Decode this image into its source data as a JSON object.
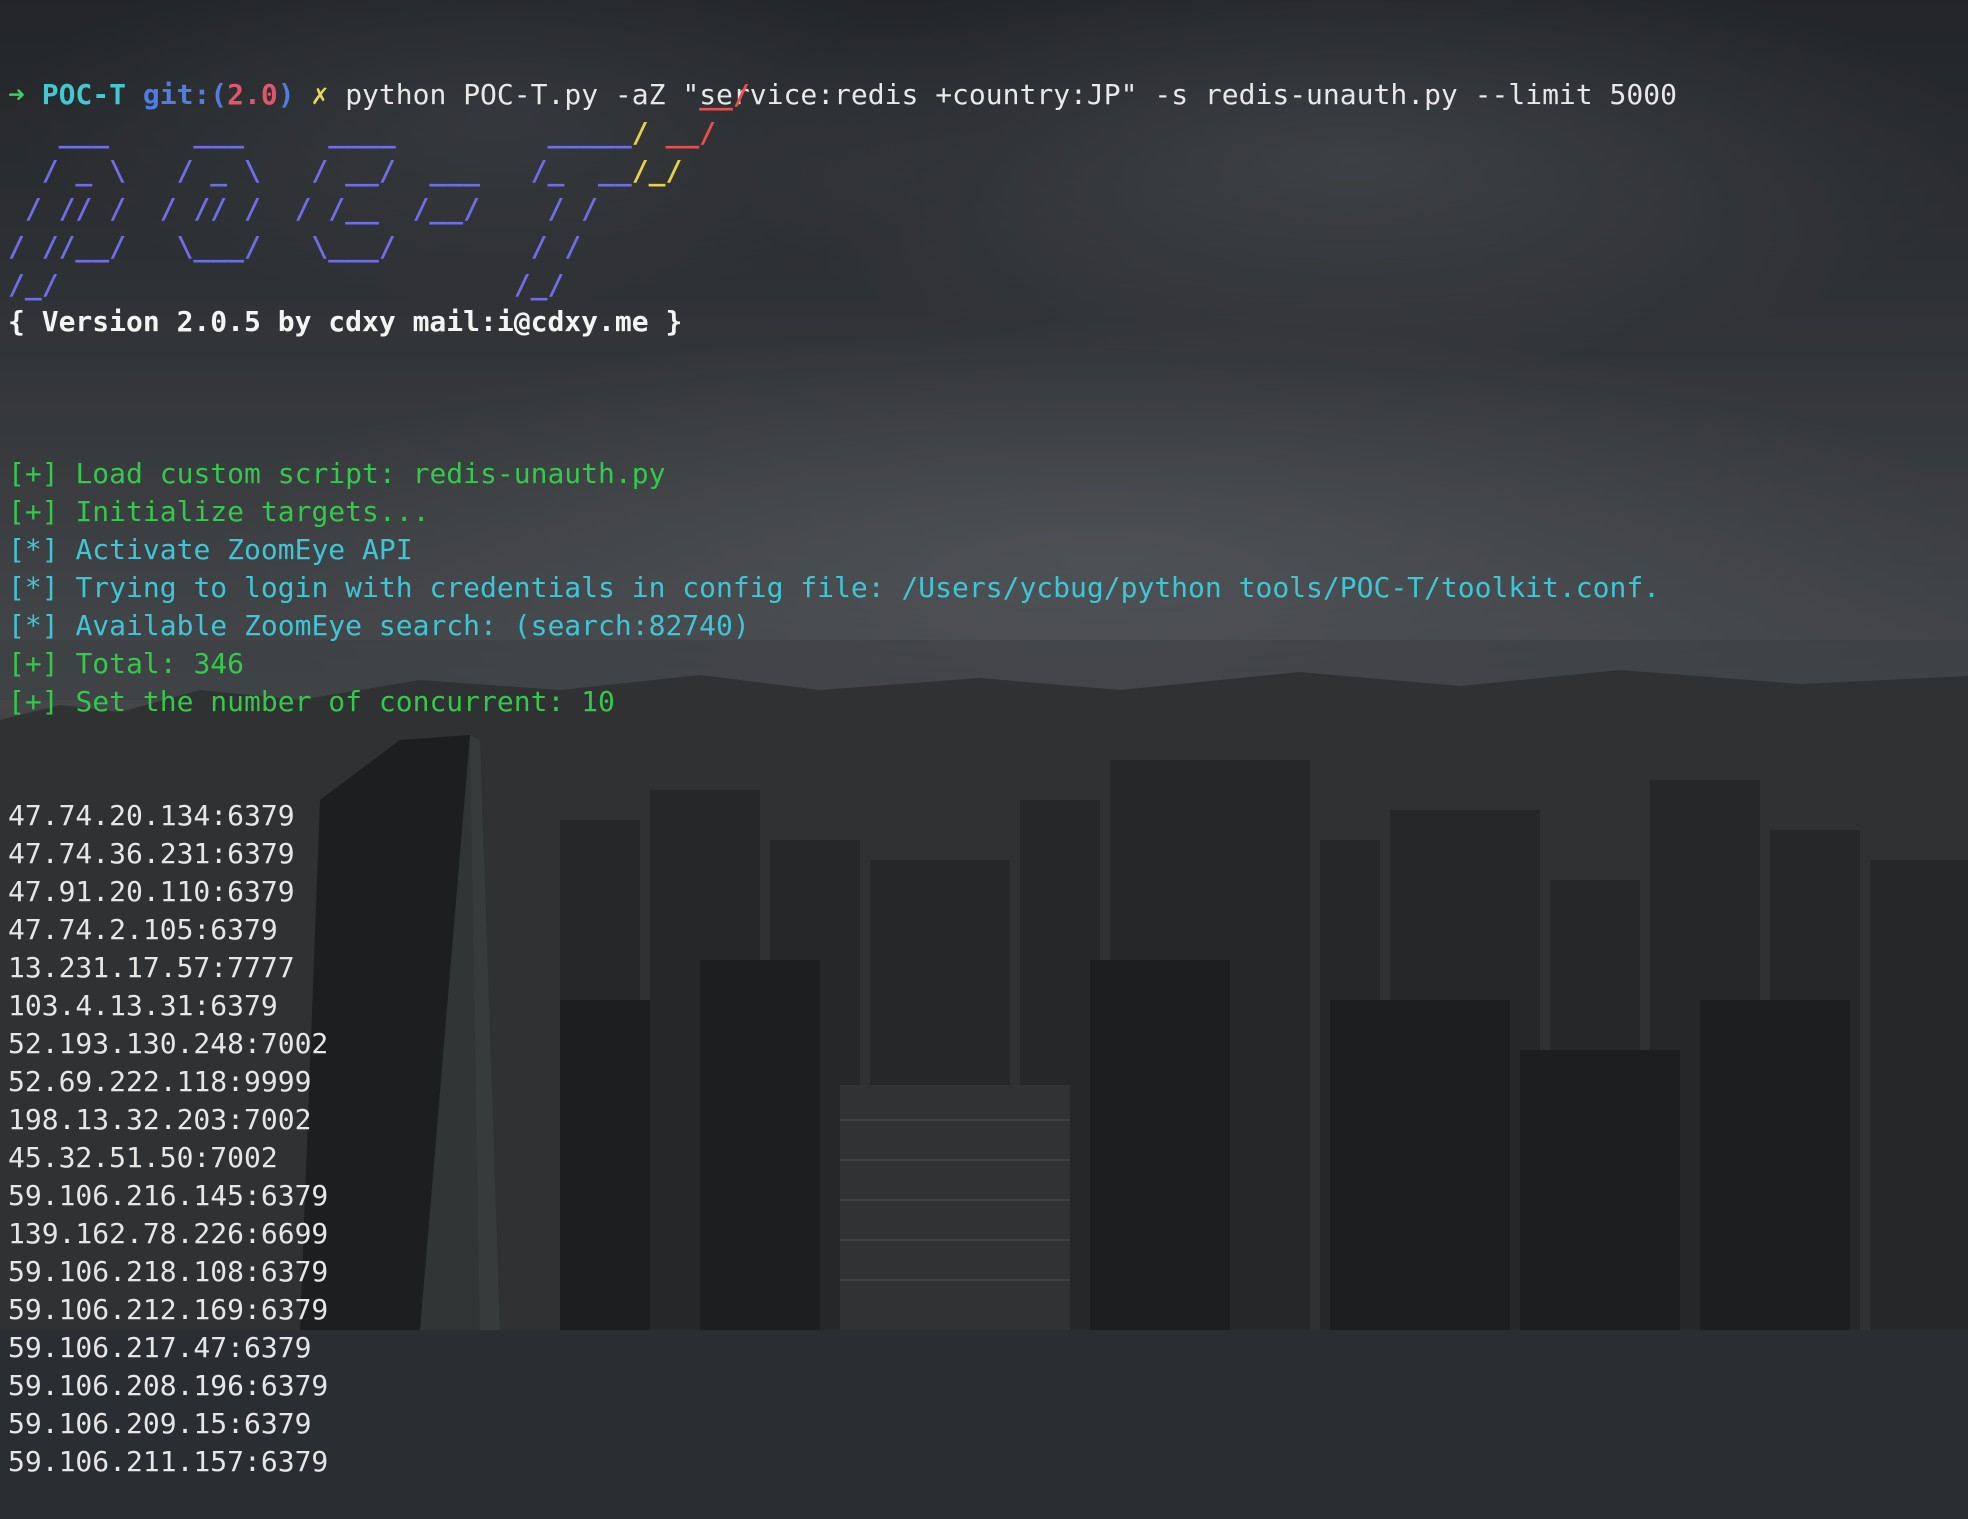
{
  "prompt": {
    "arrow": "➜",
    "cwd": "POC-T",
    "git_label": "git:(",
    "branch": "2.0",
    "git_close": ")",
    "dirty_mark": "✗",
    "command": "python POC-T.py -aZ \"service:redis +country:JP\" -s redis-unauth.py --limit 5000"
  },
  "banner": {
    "version_line": "{ Version 2.0.5 by cdxy mail:i@cdxy.me }"
  },
  "messages": [
    {
      "prefix": "[+]",
      "text": "Load custom script: redis-unauth.py",
      "color": "green"
    },
    {
      "prefix": "[+]",
      "text": "Initialize targets...",
      "color": "green"
    },
    {
      "prefix": "[*]",
      "text": "Activate ZoomEye API",
      "color": "cyan"
    },
    {
      "prefix": "[*]",
      "text": "Trying to login with credentials in config file: /Users/ycbug/python tools/POC-T/toolkit.conf.",
      "color": "cyan"
    },
    {
      "prefix": "[*]",
      "text": "Available ZoomEye search: (search:82740)",
      "color": "cyan"
    },
    {
      "prefix": "[+]",
      "text": "Total: 346",
      "color": "green"
    },
    {
      "prefix": "[+]",
      "text": "Set the number of concurrent: 10",
      "color": "green"
    }
  ],
  "targets": [
    "47.74.20.134:6379",
    "47.74.36.231:6379",
    "47.91.20.110:6379",
    "47.74.2.105:6379",
    "13.231.17.57:7777",
    "103.4.13.31:6379",
    "52.193.130.248:7002",
    "52.69.222.118:9999",
    "198.13.32.203:7002",
    "45.32.51.50:7002",
    "59.106.216.145:6379",
    "139.162.78.226:6699",
    "59.106.218.108:6379",
    "59.106.212.169:6379",
    "59.106.217.47:6379",
    "59.106.208.196:6379",
    "59.106.209.15:6379",
    "59.106.211.157:6379"
  ]
}
